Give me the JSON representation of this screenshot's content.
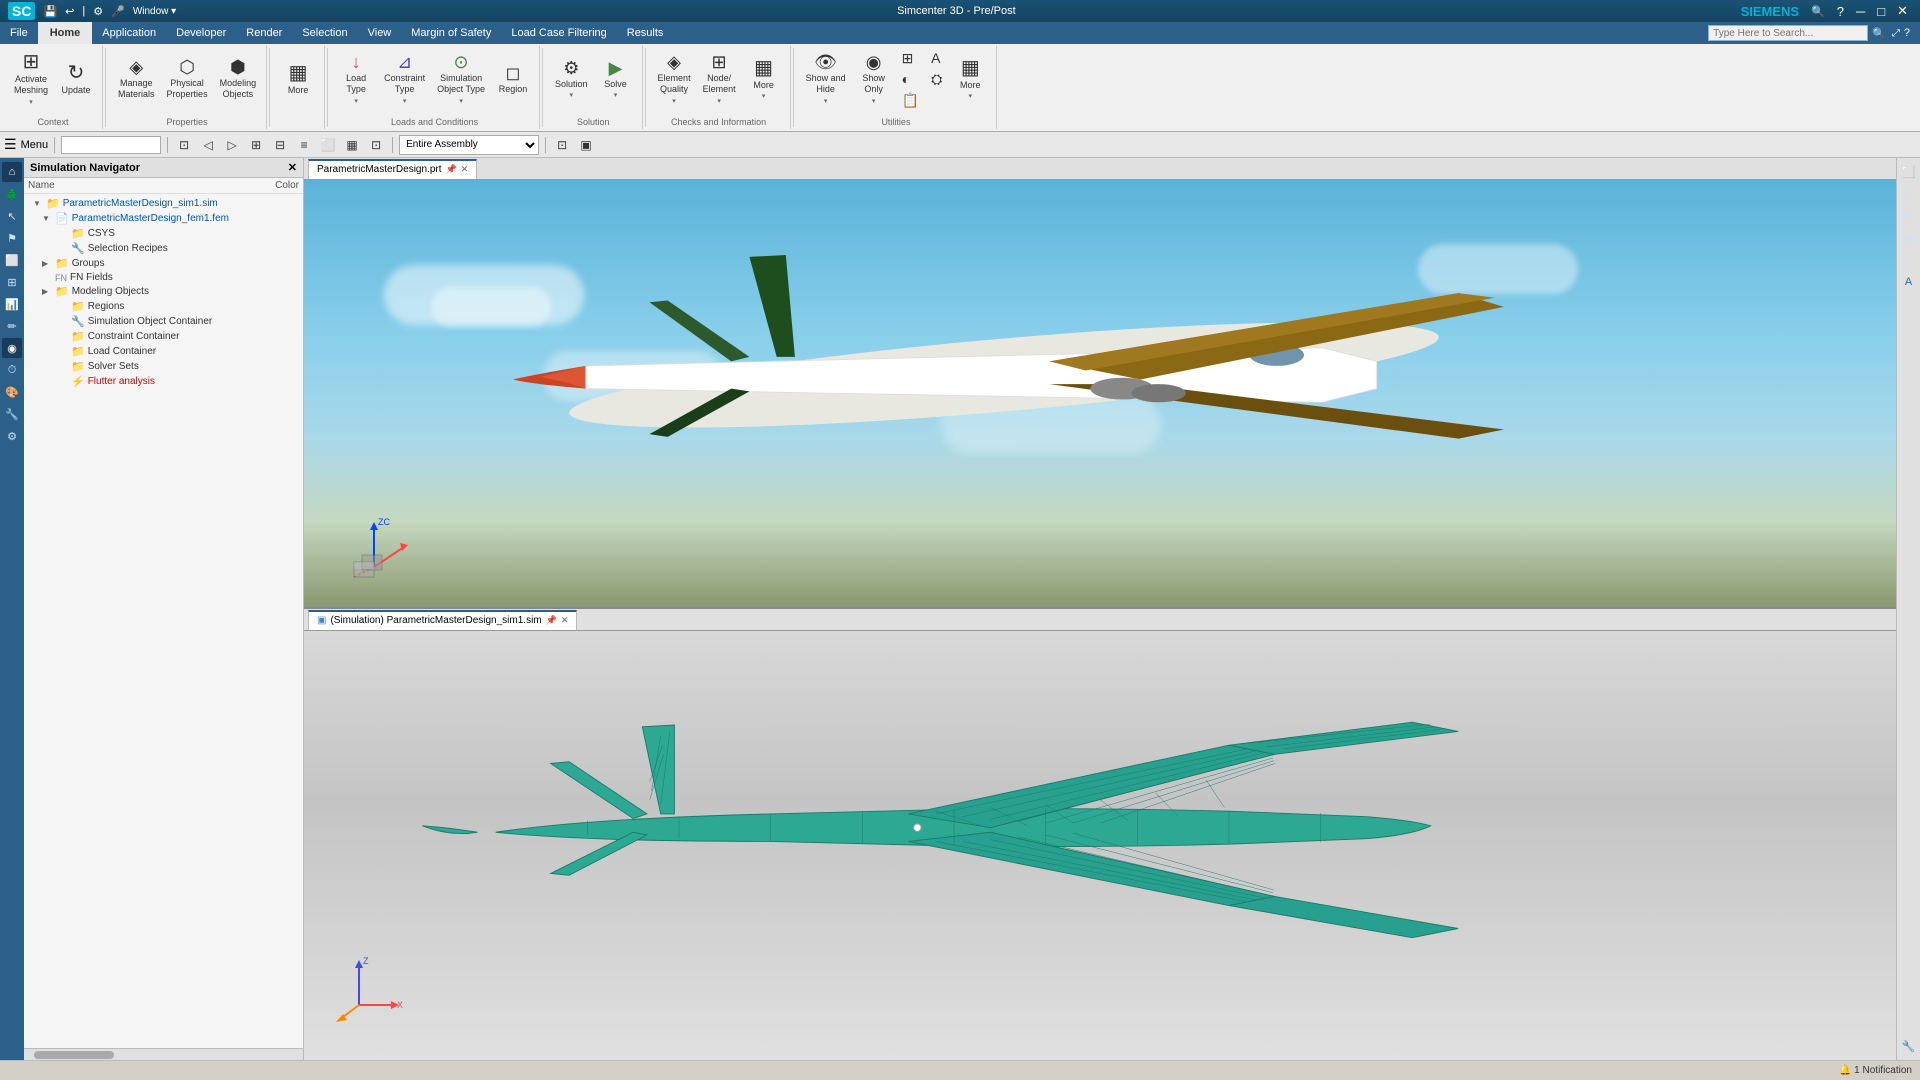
{
  "titleBar": {
    "appIcon": "SC",
    "title": "Simcenter 3D - Pre/Post",
    "brand": "SIEMENS",
    "windowControls": [
      "─",
      "□",
      "✕"
    ]
  },
  "menuBar": {
    "items": [
      "File",
      "Home",
      "Application",
      "Developer",
      "Render",
      "Selection",
      "View",
      "Margin of Safety",
      "Load Case Filtering",
      "Results"
    ],
    "activeItem": "Home",
    "searchPlaceholder": "Type Here to Search..."
  },
  "ribbon": {
    "groups": [
      {
        "id": "context",
        "label": "Context",
        "buttons": [
          {
            "id": "activate-meshing",
            "icon": "⊞",
            "label": "Activate\nMeshing",
            "hasDropdown": true
          },
          {
            "id": "update",
            "icon": "↻",
            "label": "Update"
          }
        ]
      },
      {
        "id": "properties",
        "label": "Properties",
        "buttons": [
          {
            "id": "manage-materials",
            "icon": "◈",
            "label": "Manage\nMaterials"
          },
          {
            "id": "physical-properties",
            "icon": "⬡",
            "label": "Physical\nProperties"
          },
          {
            "id": "modeling-objects",
            "icon": "⬢",
            "label": "Modeling\nObjects"
          }
        ]
      },
      {
        "id": "more-context",
        "label": "",
        "buttons": [
          {
            "id": "more",
            "icon": "▦",
            "label": "More"
          }
        ]
      },
      {
        "id": "loads-conditions",
        "label": "Loads and Conditions",
        "buttons": [
          {
            "id": "load-type",
            "icon": "↓",
            "label": "Load\nType",
            "hasDropdown": true
          },
          {
            "id": "constraint-type",
            "icon": "⊿",
            "label": "Constraint\nType",
            "hasDropdown": true
          },
          {
            "id": "simulation-object-type",
            "icon": "⊙",
            "label": "Simulation\nObject Type",
            "hasDropdown": true
          },
          {
            "id": "region",
            "icon": "◻",
            "label": "Region"
          }
        ]
      },
      {
        "id": "solution",
        "label": "Solution",
        "buttons": [
          {
            "id": "solution",
            "icon": "⚙",
            "label": "Solution",
            "hasDropdown": true
          },
          {
            "id": "solve",
            "icon": "▶",
            "label": "Solve",
            "hasDropdown": true
          }
        ]
      },
      {
        "id": "checks",
        "label": "Checks and Information",
        "buttons": [
          {
            "id": "element-quality",
            "icon": "◈",
            "label": "Element\nQuality",
            "hasDropdown": true
          },
          {
            "id": "node-element",
            "icon": "⊞",
            "label": "Node/\nElement",
            "hasDropdown": true
          },
          {
            "id": "more-checks",
            "icon": "▦",
            "label": "More",
            "hasDropdown": true
          }
        ]
      },
      {
        "id": "utilities",
        "label": "Utilities",
        "buttons": [
          {
            "id": "show-hide",
            "icon": "👁",
            "label": "Show and\nHide",
            "hasDropdown": true
          },
          {
            "id": "show-only",
            "icon": "◉",
            "label": "Show\nOnly",
            "hasDropdown": true
          },
          {
            "id": "more-util1",
            "icon": "⊞",
            "label": ""
          },
          {
            "id": "more-util2",
            "icon": "📋",
            "label": ""
          },
          {
            "id": "more-util3",
            "icon": "A",
            "label": ""
          },
          {
            "id": "more-utilities",
            "icon": "▦",
            "label": "More",
            "hasDropdown": true
          }
        ]
      }
    ]
  },
  "toolbar2": {
    "menuLabel": "Menu",
    "filterPlaceholder": "",
    "assemblySelect": "Entire Assembly",
    "iconButtons": [
      "◁",
      "▷",
      "⊞",
      "⊟",
      "≡",
      "⬜",
      "▦",
      "⊡",
      "▣"
    ],
    "rightIcons": [
      "◉",
      "⊡"
    ]
  },
  "navigatorPanel": {
    "title": "Simulation Navigator",
    "columns": [
      "Name",
      "Color"
    ],
    "treeItems": [
      {
        "id": "root",
        "indent": 0,
        "expand": "▼",
        "icon": "📁",
        "text": "ParametricMasterDesign_sim1.sim",
        "color": "blue",
        "level": 0
      },
      {
        "id": "fem",
        "indent": 1,
        "expand": "▼",
        "icon": "📄",
        "text": "ParametricMasterDesign_fem1.fem",
        "color": "blue",
        "level": 1
      },
      {
        "id": "csys",
        "indent": 2,
        "expand": "",
        "icon": "📁",
        "text": "CSYS",
        "color": "normal",
        "level": 2
      },
      {
        "id": "selection-recipes",
        "indent": 2,
        "expand": "",
        "icon": "🔧",
        "text": "Selection Recipes",
        "color": "normal",
        "level": 2
      },
      {
        "id": "groups",
        "indent": 1,
        "expand": "▶",
        "icon": "📁",
        "text": "Groups",
        "color": "normal",
        "level": 1
      },
      {
        "id": "fn-fields",
        "indent": 1,
        "expand": "",
        "icon": "⊞",
        "text": "FN Fields",
        "color": "normal",
        "level": 1
      },
      {
        "id": "modeling-objects",
        "indent": 1,
        "expand": "▶",
        "icon": "📁",
        "text": "Modeling Objects",
        "color": "normal",
        "level": 1
      },
      {
        "id": "regions",
        "indent": 2,
        "expand": "",
        "icon": "📁",
        "text": "Regions",
        "color": "normal",
        "level": 2
      },
      {
        "id": "sim-object-container",
        "indent": 2,
        "expand": "",
        "icon": "🔧",
        "text": "Simulation Object Container",
        "color": "normal",
        "level": 2
      },
      {
        "id": "constraint-container",
        "indent": 2,
        "expand": "",
        "icon": "📁",
        "text": "Constraint Container",
        "color": "normal",
        "level": 2
      },
      {
        "id": "load-container",
        "indent": 2,
        "expand": "",
        "icon": "📁",
        "text": "Load Container",
        "color": "normal",
        "level": 2
      },
      {
        "id": "solver-sets",
        "indent": 2,
        "expand": "",
        "icon": "📁",
        "text": "Solver Sets",
        "color": "normal",
        "level": 2
      },
      {
        "id": "flutter-analysis",
        "indent": 2,
        "expand": "",
        "icon": "⚡",
        "text": "Flutter analysis",
        "color": "red",
        "level": 2
      }
    ]
  },
  "viewportTop": {
    "tabLabel": "ParametricMasterDesign.prt",
    "hasClose": true,
    "hasPin": true
  },
  "viewportBottom": {
    "tabLabel": "(Simulation) ParametricMasterDesign_sim1.sim",
    "hasClose": true,
    "hasPin": true
  },
  "statusBar": {
    "notification": "🔔 1 Notification"
  }
}
